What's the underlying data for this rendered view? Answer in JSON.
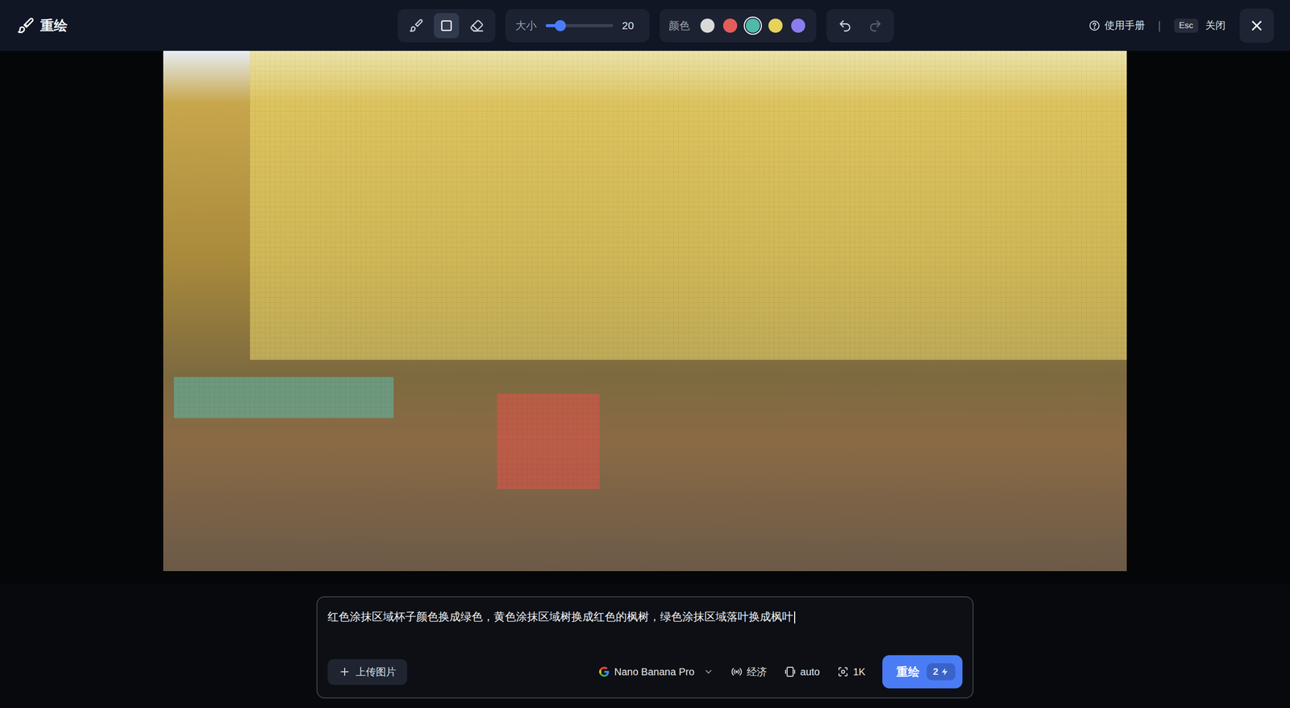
{
  "app": {
    "title": "重绘"
  },
  "toolbar": {
    "tools": [
      {
        "kind": "brush",
        "selected": false
      },
      {
        "kind": "rectangle",
        "selected": true
      },
      {
        "kind": "eraser",
        "selected": false
      }
    ],
    "size": {
      "label": "大小",
      "value": "20",
      "level": 0.22
    },
    "colors": {
      "label": "颜色",
      "swatches": [
        {
          "color": "#d9d9d9",
          "selected": false
        },
        {
          "color": "#e35d5b",
          "selected": false
        },
        {
          "color": "#4fb9aa",
          "selected": true
        },
        {
          "color": "#e8d25a",
          "selected": false
        },
        {
          "color": "#8b7cf0",
          "selected": false
        }
      ]
    },
    "history": {
      "undo": {
        "disabled": false
      },
      "redo": {
        "disabled": true
      }
    },
    "help": {
      "label": "使用手册"
    },
    "separator": "|",
    "close": {
      "key": "Esc",
      "label": "关闭"
    }
  },
  "canvas": {
    "masks": [
      {
        "color": "#f0dc6e"
      },
      {
        "color": "#5fbfae"
      },
      {
        "color": "#e5534b"
      }
    ]
  },
  "prompt": {
    "text": "红色涂抹区域杯子颜色换成绿色，黄色涂抹区域树换成红色的枫树，绿色涂抹区域落叶换成枫叶",
    "upload": "上传图片",
    "model": "Nano Banana Pro",
    "mode": "经济",
    "ratio": "auto",
    "resolution": "1K",
    "submit": "重绘",
    "cost": "2"
  }
}
